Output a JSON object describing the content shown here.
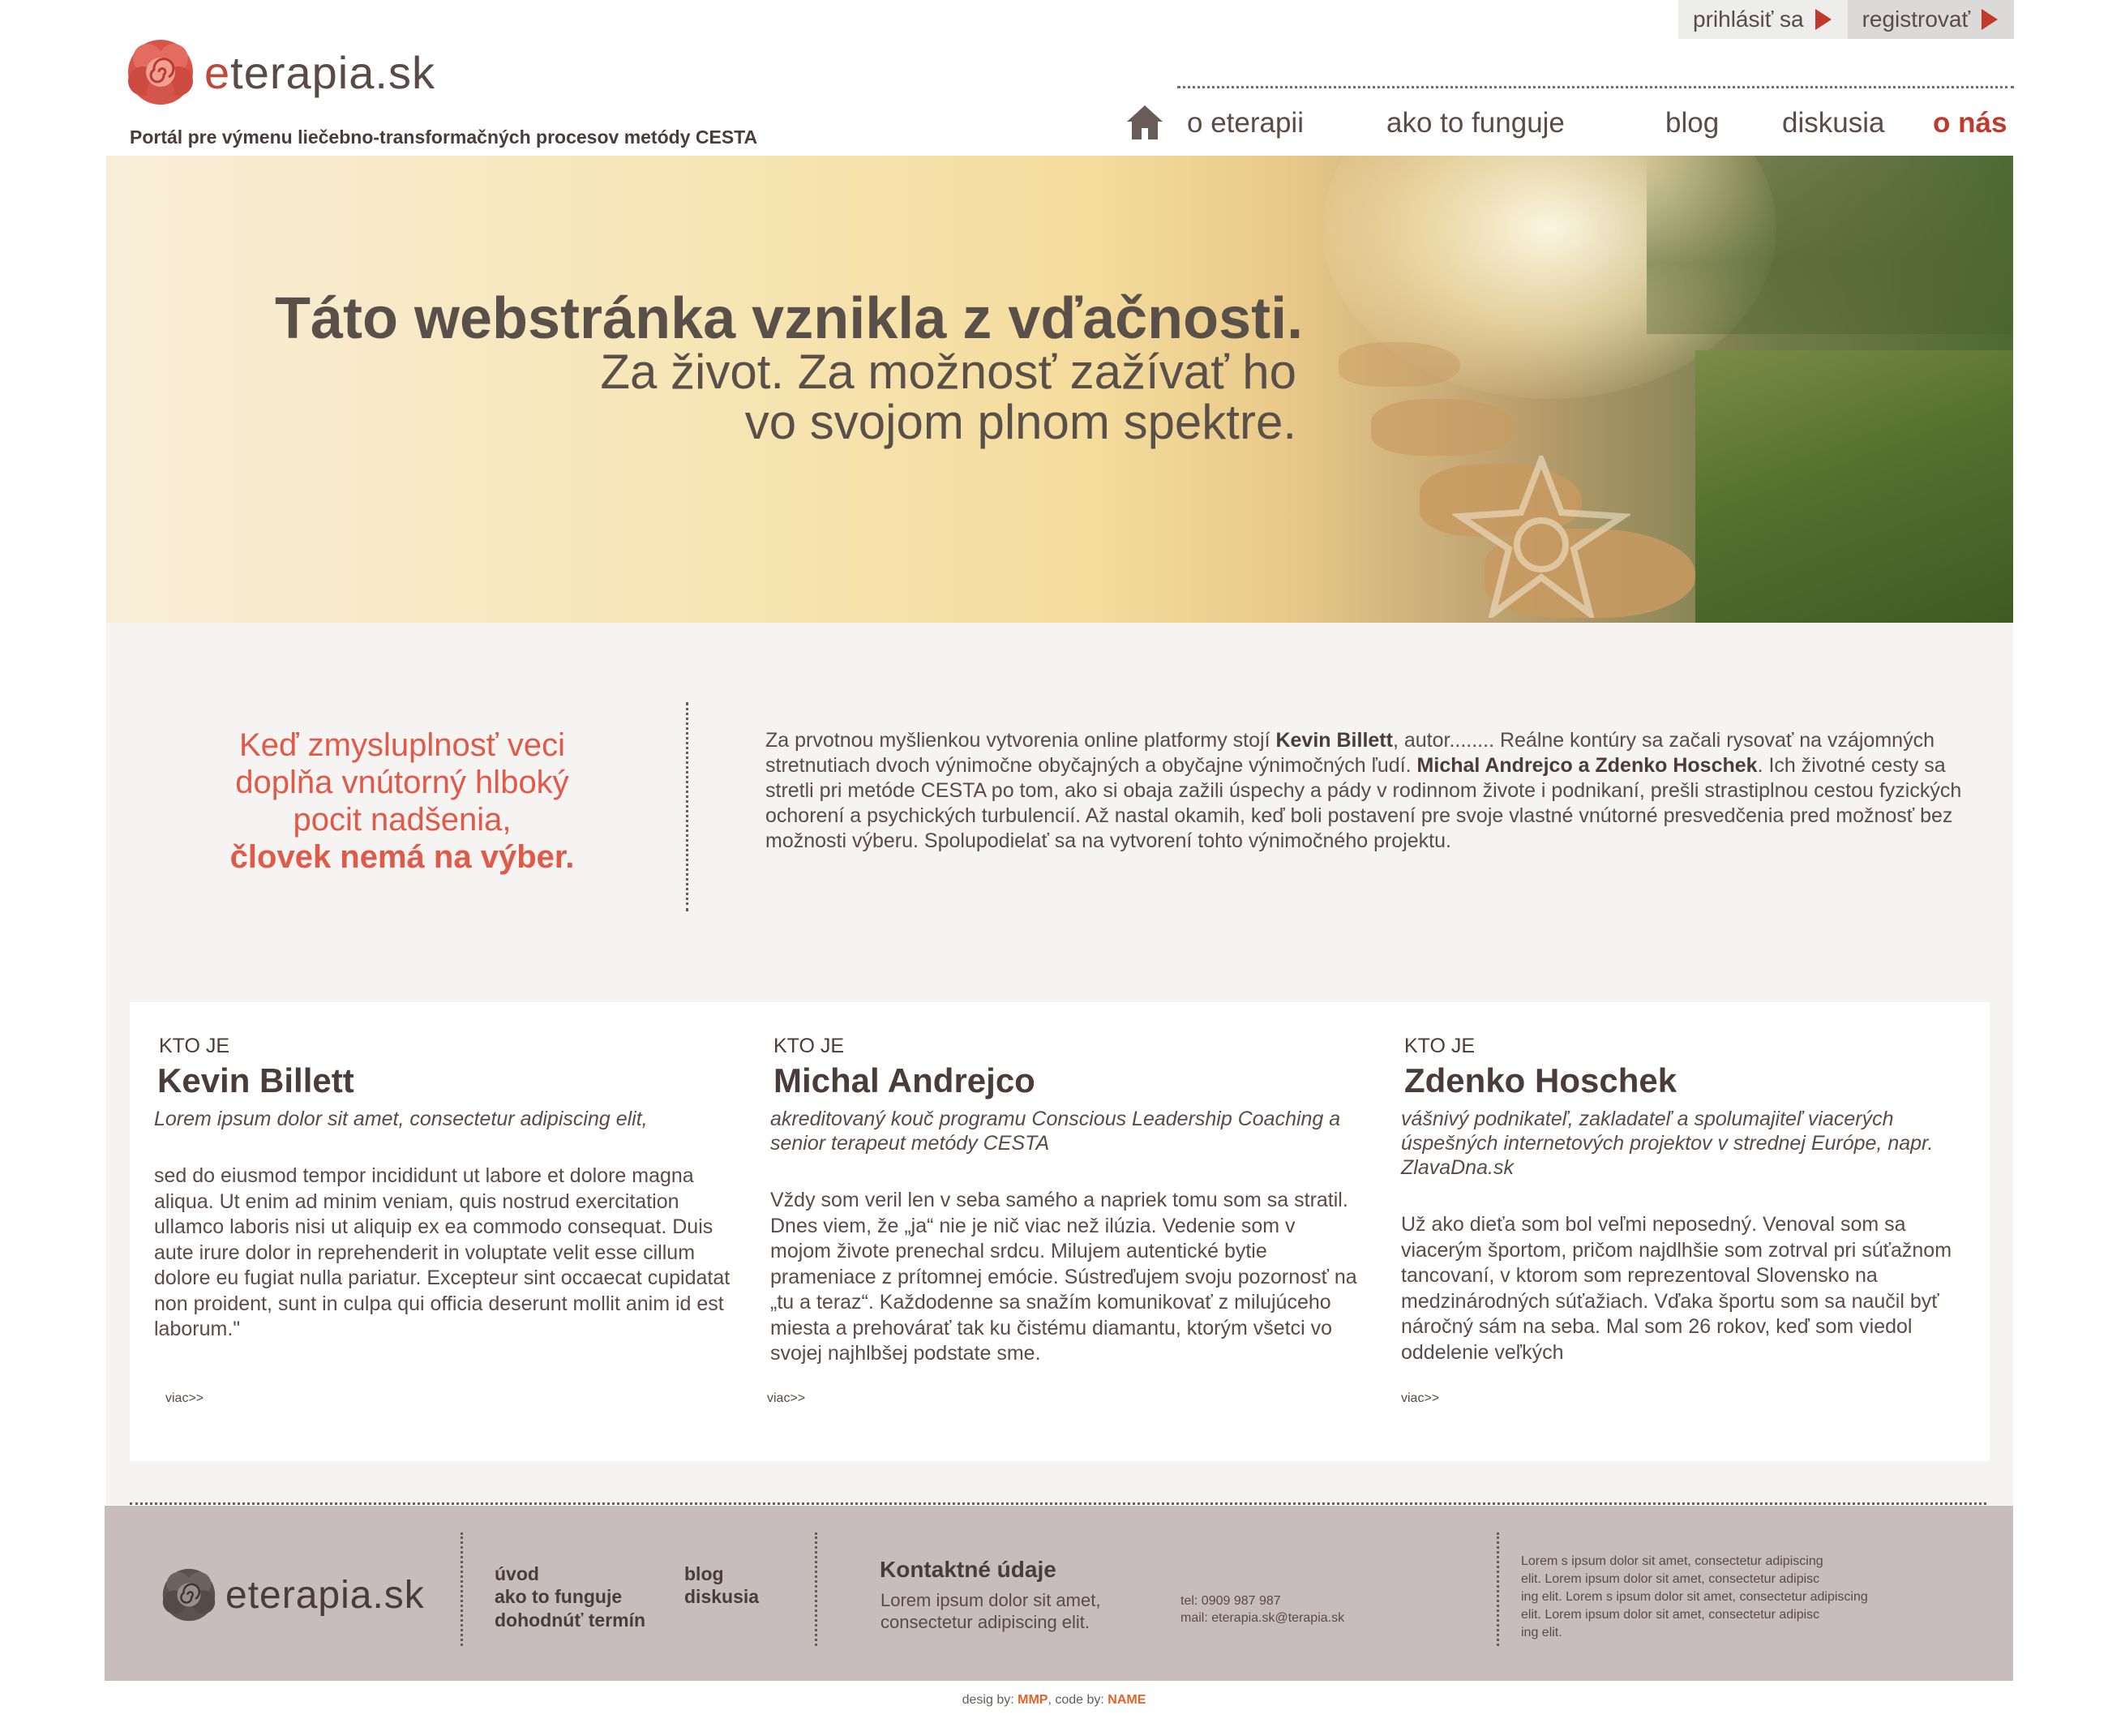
{
  "header": {
    "login_label": "prihlásiť sa",
    "register_label": "registrovať",
    "logo_text_e": "e",
    "logo_text_rest": "terapia.sk",
    "tagline": "Portál pre výmenu liečebno-transformačných procesov metódy CESTA"
  },
  "nav": {
    "items": [
      {
        "label": "o eterapii"
      },
      {
        "label": "ako to funguje"
      },
      {
        "label": "blog"
      },
      {
        "label": "diskusia"
      },
      {
        "label": "o nás"
      }
    ]
  },
  "hero": {
    "headline": "Táto webstránka vznikla z vďačnosti.",
    "sub_line1": "Za život. Za možnosť zažívať ho",
    "sub_line2": "vo svojom plnom spektre."
  },
  "quote": {
    "line1": "Keď zmysluplnosť veci",
    "line2": "doplňa vnútorný hlboký",
    "line3": "pocit nadšenia,",
    "line4": "človek nemá na výber."
  },
  "intro": {
    "p1": "Za prvotnou myšlienkou vytvorenia online platformy stojí ",
    "name1": "Kevin Billett",
    "p2": ", autor........ Reálne kontúry sa začali rysovať na vzájomných stretnutiach dvoch výnimočne obyčajných a obyčajne výnimočných ľudí. ",
    "name2": "Michal Andrejco a Zdenko Hoschek",
    "p3": ". Ich životné cesty sa stretli pri metóde CESTA po tom, ako si obaja zažili úspechy a pády v rodinnom živote i podnikaní, prešli strastiplnou cestou fyzických ochorení a psychických turbulencií. Až nastal okamih, keď  boli postavení pre svoje vlastné vnútorné presvedčenia pred možnosť bez možnosti výberu. Spolupodielať sa na vytvorení tohto výnimočného projektu."
  },
  "cards": [
    {
      "kicker": "KTO JE",
      "name": "Kevin Billett",
      "role": "Lorem ipsum dolor sit amet, consectetur adipiscing elit,",
      "bio": "sed do eiusmod tempor incididunt ut labore et dolore magna aliqua. Ut enim ad minim veniam, quis nostrud exercitation ullamco laboris nisi ut aliquip ex ea commodo consequat. Duis aute irure dolor in reprehenderit in voluptate velit esse cillum dolore eu fugiat nulla pariatur. Excepteur sint occaecat cupidatat non proident, sunt in culpa qui officia deserunt mollit anim id est laborum.\"",
      "more": "viac>>"
    },
    {
      "kicker": "KTO JE",
      "name": "Michal Andrejco",
      "role": "akreditovaný kouč programu Conscious Leadership Coaching a senior terapeut metódy CESTA",
      "bio": "Vždy som veril len v seba samého a napriek tomu som sa stratil. Dnes viem, že „ja“ nie je nič viac než ilúzia. Vedenie som v mojom živote prenechal srdcu. Milujem autentické bytie prameniace z prítomnej emócie. Sústreďujem svoju pozornosť na „tu a teraz“. Každodenne sa snažím komunikovať z milujúceho miesta a prehovárať tak ku čistému diamantu, ktorým všetci vo svojej najhlbšej podstate sme.",
      "more": "viac>>"
    },
    {
      "kicker": "KTO JE",
      "name": "Zdenko Hoschek",
      "role": "vášnivý podnikateľ, zakladateľ a spolumajiteľ viacerých úspešných internetových projektov v strednej Európe, napr. ZlavaDna.sk",
      "bio": "Už ako dieťa som bol veľmi neposedný. Venoval som sa viacerým športom, pričom najdlhšie som zotrval pri súťažnom tancovaní, v ktorom som reprezentoval Slovensko na medzinárodných súťažiach. Vďaka športu som sa naučil byť náročný sám na seba. Mal som 26 rokov, keď som viedol oddelenie veľkých",
      "more": "viac>>"
    }
  ],
  "footer": {
    "logo_text_e": "e",
    "logo_text_rest": "terapia.sk",
    "links_col1": [
      "úvod",
      "ako to funguje",
      "dohodnúť termín"
    ],
    "links_col2": [
      "blog",
      "diskusia"
    ],
    "contact_title": "Kontaktné údaje",
    "contact_line1": "Lorem ipsum dolor sit amet,",
    "contact_line2": "consectetur adipiscing elit.",
    "tel": "tel:   0909 987 987",
    "mail": "mail: eterapia.sk@terapia.sk",
    "small_lines": [
      "Lorem s ipsum dolor sit amet, consectetur adipiscing",
      "elit. Lorem ipsum dolor sit amet, consectetur adipisc",
      "ing elit. Lorem s ipsum dolor sit amet, consectetur adipiscing",
      "elit. Lorem ipsum dolor sit amet, consectetur adipisc",
      "ing elit."
    ],
    "credits_prefix": "desig by: ",
    "credits_design": "MMP",
    "credits_mid": ", code by: ",
    "credits_code": "NAME"
  },
  "colors": {
    "accent_red": "#c0392b",
    "quote_red": "#e05a4a",
    "text_brown": "#5a4a48",
    "footer_bg": "#c9bcbc",
    "section_bg": "#f5f4f2"
  },
  "icons": [
    "rose-logo-icon",
    "home-icon",
    "play-triangle-icon",
    "star-camera-icon"
  ]
}
